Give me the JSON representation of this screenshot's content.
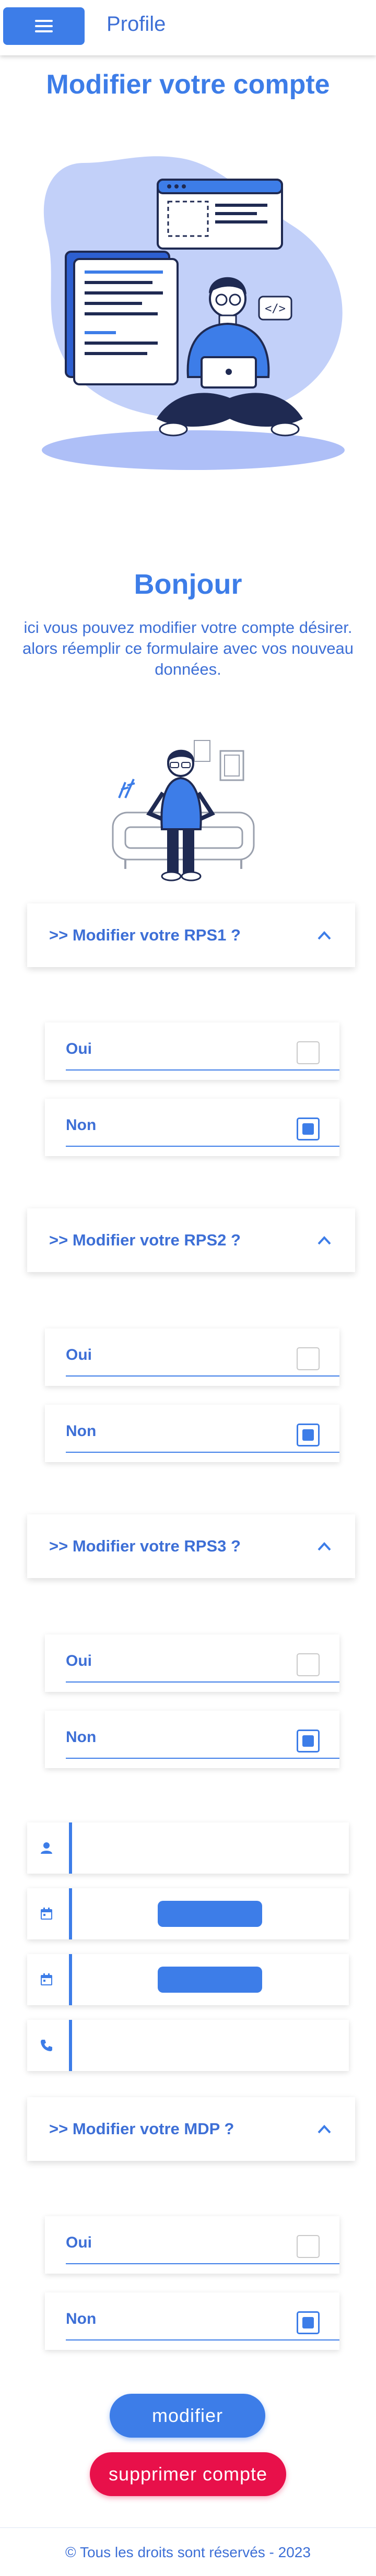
{
  "header": {
    "title": "Profile",
    "menu_icon": "hamburger-menu-icon"
  },
  "page_title": "Modifier votre compte",
  "greeting": "Bonjour",
  "intro": "ici vous pouvez modifier votre compte désirer. alors réemplir ce formulaire avec vos nouveau données.",
  "sections": [
    {
      "label": ">> Modifier votre RPS1 ?",
      "options": [
        {
          "label": "Oui",
          "checked": false
        },
        {
          "label": "Non",
          "checked": true
        }
      ]
    },
    {
      "label": ">> Modifier votre RPS2 ?",
      "options": [
        {
          "label": "Oui",
          "checked": false
        },
        {
          "label": "Non",
          "checked": true
        }
      ]
    },
    {
      "label": ">> Modifier votre RPS3 ?",
      "options": [
        {
          "label": "Oui",
          "checked": false
        },
        {
          "label": "Non",
          "checked": true
        }
      ]
    }
  ],
  "fields": [
    {
      "icon": "person-icon",
      "value": ""
    },
    {
      "icon": "calendar-icon",
      "value": ""
    },
    {
      "icon": "calendar-icon",
      "value": ""
    },
    {
      "icon": "phone-icon",
      "value": ""
    }
  ],
  "mdp_section": {
    "label": ">> Modifier votre MDP ?",
    "options": [
      {
        "label": "Oui",
        "checked": false
      },
      {
        "label": "Non",
        "checked": true
      }
    ]
  },
  "buttons": {
    "modify": "modifier",
    "delete": "supprimer compte"
  },
  "footer": "© Tous les droits sont réservés - 2023",
  "colors": {
    "primary": "#3d7de8",
    "danger": "#e8104a",
    "text": "#3d6fd6"
  }
}
